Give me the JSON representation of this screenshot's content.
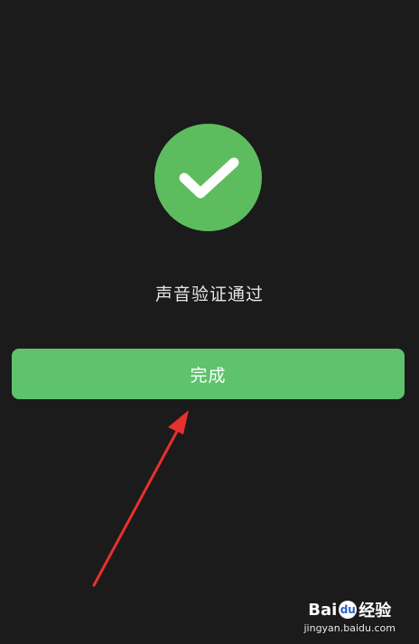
{
  "status": {
    "message": "声音验证通过"
  },
  "actions": {
    "done_label": "完成"
  },
  "watermark": {
    "brand_left": "Bai",
    "brand_paw": "du",
    "brand_right": "经验",
    "url": "jingyan.baidu.com"
  },
  "icons": {
    "success": "checkmark-icon",
    "annotation": "red-arrow-icon"
  },
  "colors": {
    "background": "#1b1b1b",
    "success_green": "#5dbd5e",
    "button_green": "#5ec36c",
    "annotation_red": "#e8302f"
  }
}
